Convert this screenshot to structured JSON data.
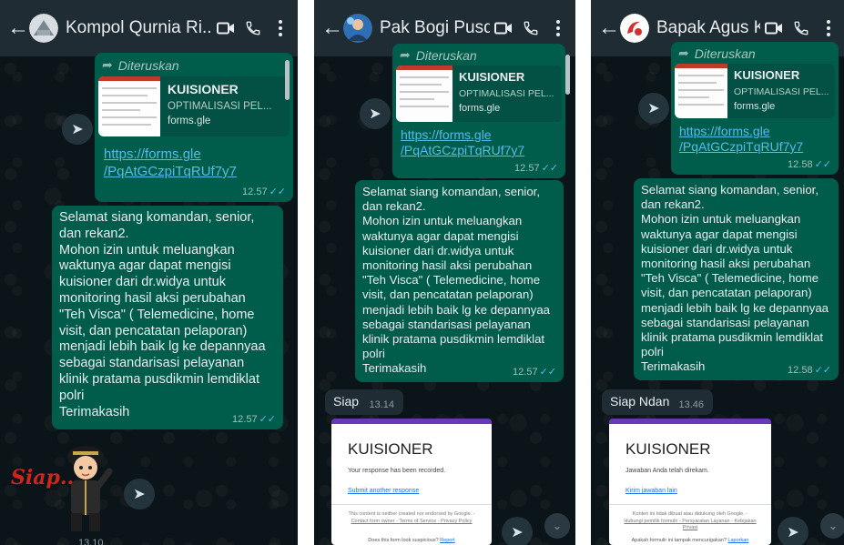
{
  "panels": [
    {
      "contact_name": "Kompol Qurnia Ri...",
      "forwarded_label": "Diteruskan",
      "link_preview": {
        "title": "KUISIONER",
        "subtitle": "OPTIMALISASI PEL...",
        "domain": "forms.gle"
      },
      "link_url": "https://forms.gle\n/PqAtGCzpiTqRUf7y7",
      "link_time": "12.57",
      "message_text": "Selamat siang komandan, senior, dan rekan2.\nMohon izin untuk meluangkan waktunya agar dapat mengisi kuisioner dari dr.widya untuk monitoring hasil aksi perubahan \"Teh Visca\" ( Telemedicine, home visit, dan pencatatan pelaporan) menjadi lebih baik lg ke depannyaa sebagai standarisasi pelayanan klinik pratama pusdikmin lemdiklat polri\nTerimakasih",
      "message_time": "12.57",
      "sticker_text": "Siap..",
      "sticker_time": "13.10"
    },
    {
      "contact_name": "Pak Bogi Pusdik...",
      "forwarded_label": "Diteruskan",
      "link_preview": {
        "title": "KUISIONER",
        "subtitle": "OPTIMALISASI PEL...",
        "domain": "forms.gle"
      },
      "link_url": "https://forms.gle\n/PqAtGCzpiTqRUf7y7",
      "link_time": "12.57",
      "message_text": "Selamat siang komandan, senior, dan rekan2.\nMohon izin untuk meluangkan waktunya agar dapat mengisi kuisioner dari dr.widya untuk monitoring hasil aksi perubahan \"Teh Visca\" ( Telemedicine, home visit, dan pencatatan pelaporan) menjadi lebih baik lg ke depannyaa sebagai standarisasi pelayanan klinik pratama pusdikmin lemdiklat polri\nTerimakasih",
      "message_time": "12.57",
      "reply_text": "Siap",
      "reply_time": "13.14",
      "form_card": {
        "title": "KUISIONER",
        "response": "Your response has been recorded.",
        "another_link": "Submit another response",
        "disclaimer_pre": "This content is neither created nor endorsed by Google. -",
        "disclaimer_links": "Contact form owner - Terms of Service - Privacy Policy",
        "footer_q": "Does this form look suspicious?",
        "footer_link": "Report"
      }
    },
    {
      "contact_name": "Bapak Agus Kus...",
      "forwarded_label": "Diteruskan",
      "link_preview": {
        "title": "KUISIONER",
        "subtitle": "OPTIMALISASI PEL...",
        "domain": "forms.gle"
      },
      "link_url": "https://forms.gle\n/PqAtGCzpiTqRUf7y7",
      "link_time": "12.58",
      "message_text": "Selamat siang komandan, senior, dan rekan2.\nMohon izin untuk meluangkan waktunya agar dapat mengisi kuisioner dari dr.widya untuk monitoring hasil aksi perubahan \"Teh Visca\" ( Telemedicine, home visit, dan pencatatan pelaporan) menjadi lebih baik lg ke depannyaa sebagai standarisasi pelayanan klinik pratama pusdikmin lemdiklat polri\nTerimakasih",
      "message_time": "12.58",
      "reply_text": "Siap Ndan",
      "reply_time": "13.46",
      "form_card": {
        "title": "KUISIONER",
        "response": "Jawaban Anda telah direkam.",
        "another_link": "Kirim jawaban lain",
        "disclaimer_pre": "Konten ini tidak dibuat atau didukung oleh Google. -",
        "disclaimer_links": "Hubungi pemilik formulir - Persyaratan Layanan - Kebijakan Privasi",
        "footer_q": "Apakah formulir ini tampak mencurigakan?",
        "footer_link": "Laporkan"
      }
    }
  ],
  "colors": {
    "header": "#1f2c33",
    "outgoing": "#005c4b",
    "incoming": "#1f2c34",
    "link": "#53bdeb",
    "form_accent": "#673ab7"
  },
  "icons": {
    "back": "arrow-left-icon",
    "video": "video-call-icon",
    "call": "phone-icon",
    "menu": "more-vert-icon",
    "share": "forward-share-icon",
    "scroll": "chevron-double-down-icon"
  }
}
